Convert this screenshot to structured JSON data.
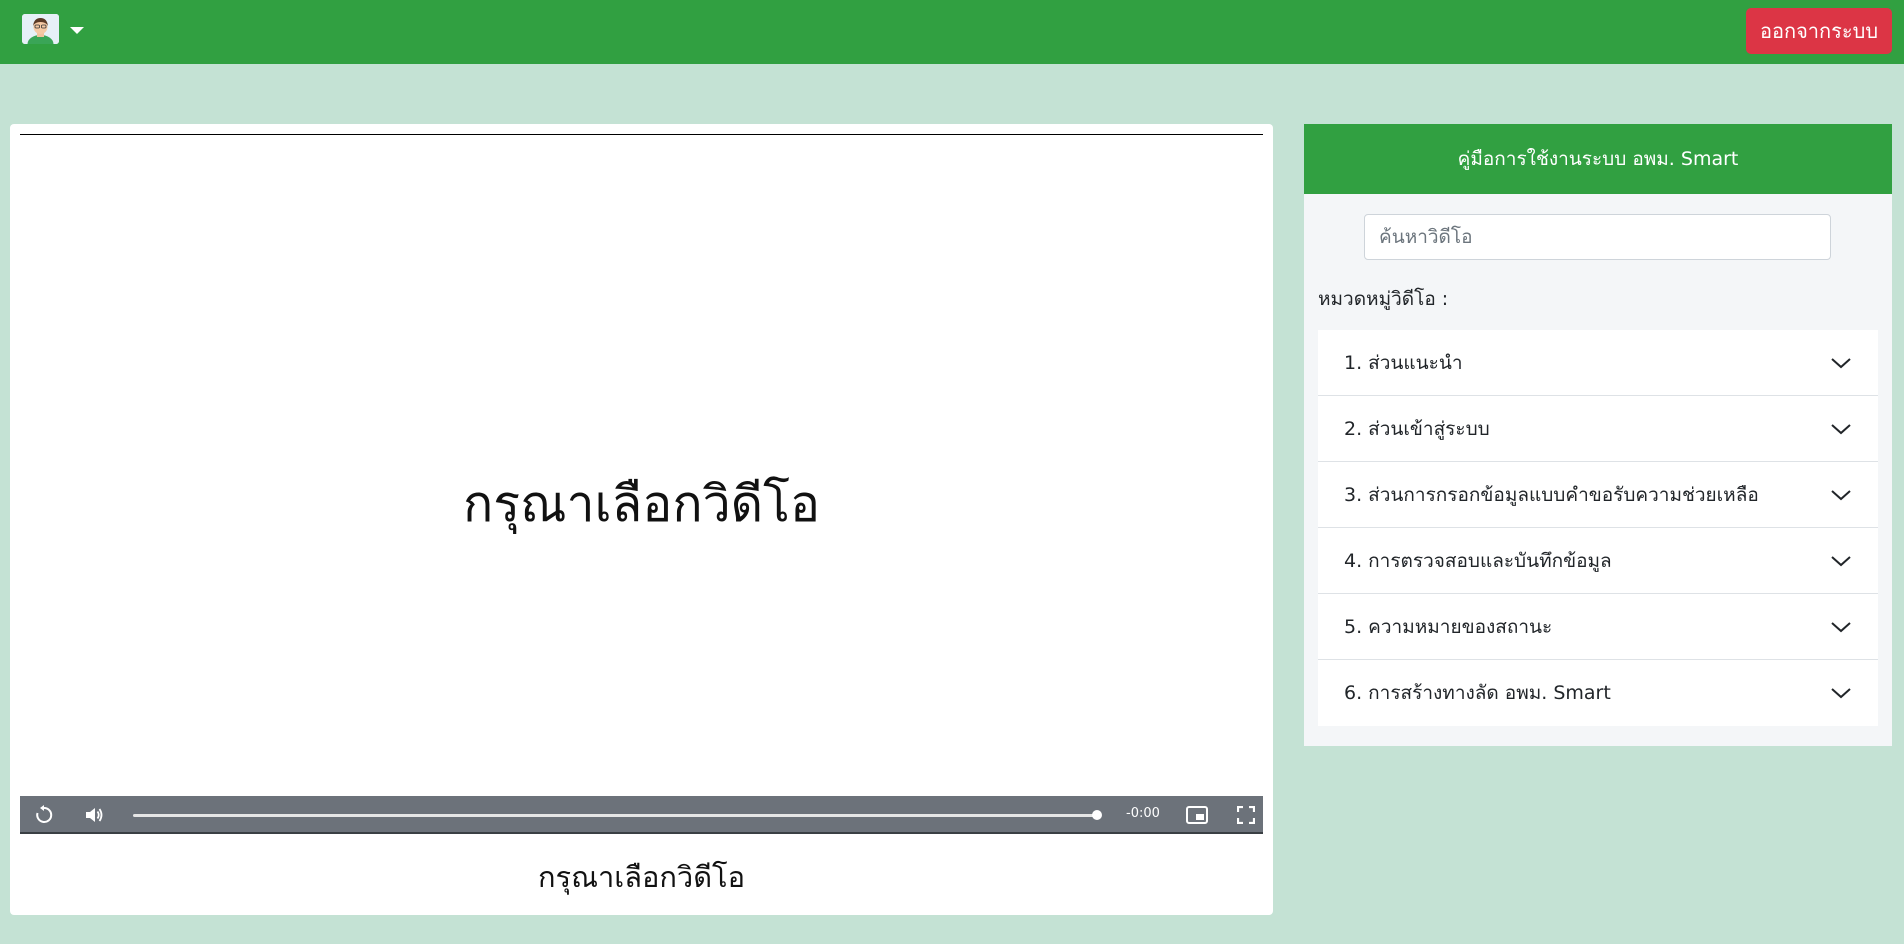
{
  "header": {
    "logout_label": "ออกจากระบบ",
    "avatar_icon": "user-avatar-icon",
    "dropdown_icon": "caret-down-icon"
  },
  "video": {
    "placeholder": "กรุณาเลือกวิดีโอ",
    "caption": "กรุณาเลือกวิดีโอ",
    "time": "-0:00",
    "progress": 1.0,
    "controls": [
      "replay-icon",
      "volume-icon",
      "picture-in-picture-icon",
      "fullscreen-icon"
    ]
  },
  "sidebar": {
    "title": "คู่มือการใช้งานระบบ อพม. Smart",
    "search_placeholder": "ค้นหาวิดีโอ",
    "category_label": "หมวดหมู่วิดีโอ :",
    "items": [
      {
        "label": "1. ส่วนแนะนำ"
      },
      {
        "label": "2. ส่วนเข้าสู่ระบบ"
      },
      {
        "label": "3. ส่วนการกรอกข้อมูลแบบคำขอรับความช่วยเหลือ"
      },
      {
        "label": "4. การตรวจสอบและบันทึกข้อมูล"
      },
      {
        "label": "5. ความหมายของสถานะ"
      },
      {
        "label": "6. การสร้างทางลัด อพม. Smart"
      }
    ]
  },
  "colors": {
    "primary_green": "#31a041",
    "page_bg": "#c4e2d4",
    "danger": "#dc3545"
  }
}
